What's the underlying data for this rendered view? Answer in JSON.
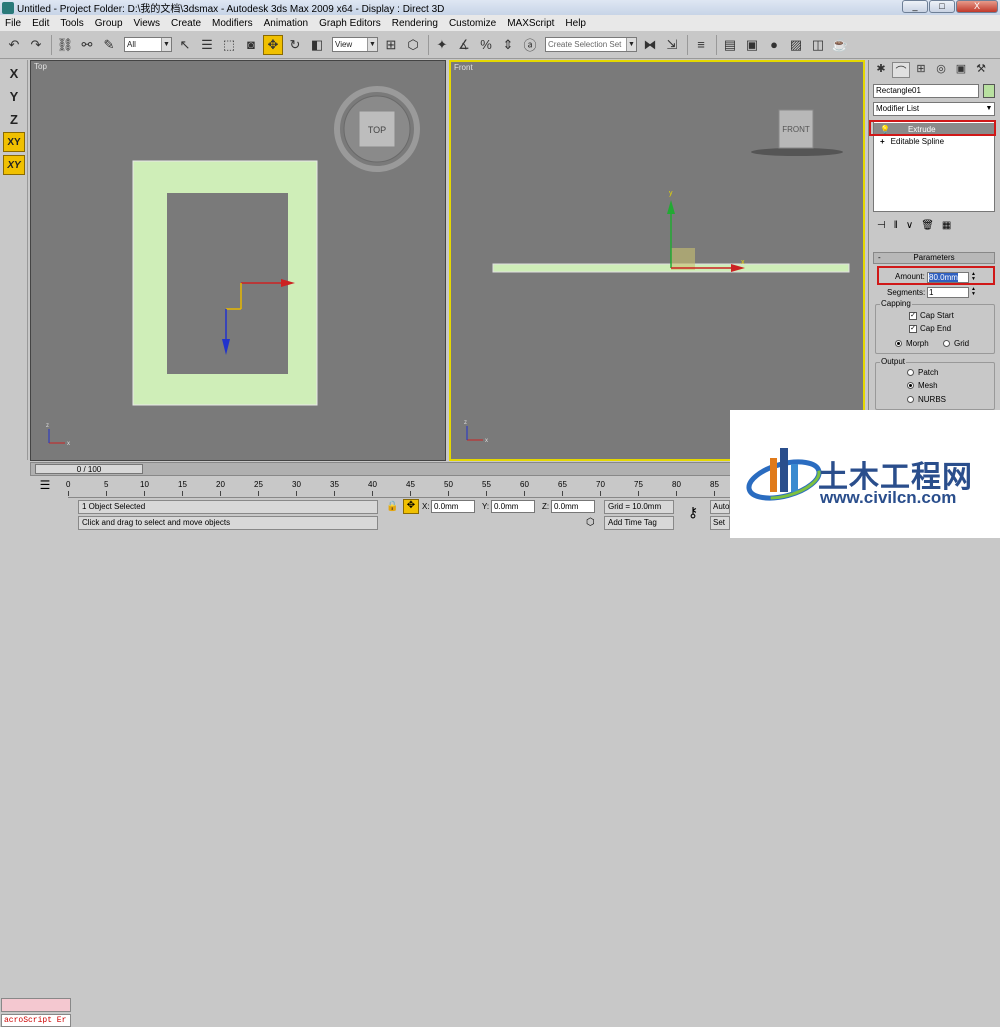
{
  "title": {
    "text": "Untitled     - Project Folder: D:\\我的文档\\3dsmax     - Autodesk 3ds Max  2009 x64     - Display : Direct 3D"
  },
  "window_buttons": {
    "minimize": "_",
    "maximize": "□",
    "close": "X"
  },
  "menu": [
    "File",
    "Edit",
    "Tools",
    "Group",
    "Views",
    "Create",
    "Modifiers",
    "Animation",
    "Graph Editors",
    "Rendering",
    "Customize",
    "MAXScript",
    "Help"
  ],
  "toolbar": {
    "filter_value": "All",
    "refcoord_value": "View",
    "named_selection_placeholder": "Create Selection Set"
  },
  "axis_constraints": [
    "X",
    "Y",
    "Z",
    "XY",
    "XY"
  ],
  "viewports": {
    "top_label": "Top",
    "front_label": "Front",
    "viewcube_top": "TOP",
    "viewcube_front": "FRONT",
    "gizmo_y": "y",
    "gizmo_x": "x",
    "axis_x": "x",
    "axis_y": "y",
    "axis_z": "z"
  },
  "command_panel": {
    "object_name": "Rectangle01",
    "modifier_list": "Modifier List",
    "stack": [
      "Extrude",
      "Editable Spline"
    ],
    "parameters_title": "Parameters",
    "amount_label": "Amount:",
    "amount_value": "80.0mm",
    "segments_label": "Segments:",
    "segments_value": "1",
    "capping_title": "Capping",
    "cap_start": "Cap Start",
    "cap_end": "Cap End",
    "morph": "Morph",
    "grid": "Grid",
    "output_title": "Output",
    "patch": "Patch",
    "mesh": "Mesh",
    "nurbs": "NURBS",
    "colors": {
      "swatch": "#b8e0a0"
    }
  },
  "timeline": {
    "slider_text": "0 / 100",
    "ticks": [
      "0",
      "5",
      "10",
      "15",
      "20",
      "25",
      "30",
      "35",
      "40",
      "45",
      "50",
      "55",
      "60",
      "65",
      "70",
      "75",
      "80",
      "85"
    ]
  },
  "status": {
    "selection": "1 Object Selected",
    "prompt": "Click and drag to select and move objects",
    "x_label": "X:",
    "x_value": "0.0mm",
    "y_label": "Y:",
    "y_value": "0.0mm",
    "z_label": "Z:",
    "z_value": "0.0mm",
    "grid": "Grid = 10.0mm",
    "add_time_tag": "Add Time Tag",
    "auto_key": "Auto",
    "set_key": "Set",
    "listener_text": "acroScript Er"
  },
  "watermark": {
    "title": "土木工程网",
    "url": "www.civilcn.com"
  }
}
